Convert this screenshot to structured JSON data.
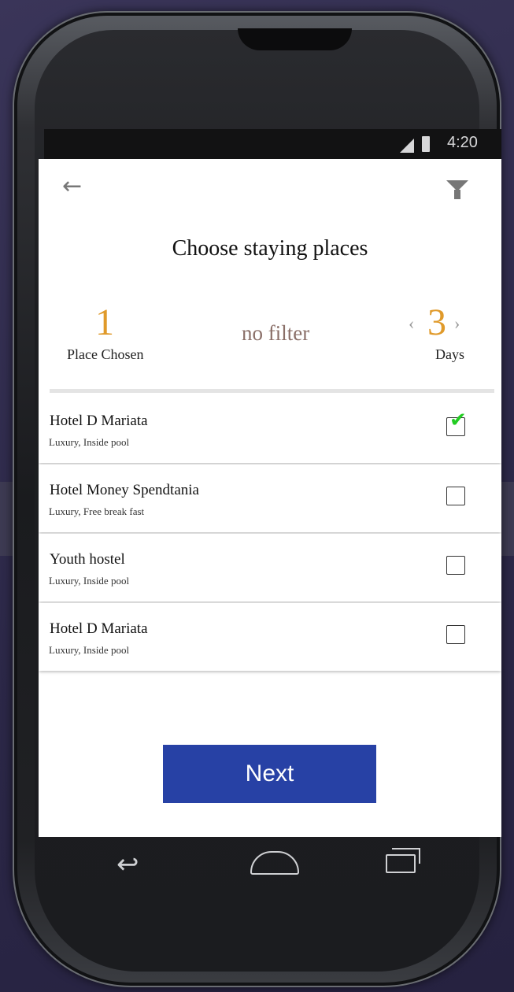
{
  "status_bar": {
    "time": "4:20"
  },
  "header": {
    "title": "Choose staying places"
  },
  "summary": {
    "places_count": "1",
    "places_label": "Place Chosen",
    "filter_text": "no filter",
    "days_prev": "‹",
    "days_count": "3",
    "days_next": "›",
    "days_label": "Days"
  },
  "places": [
    {
      "name": "Hotel D Mariata",
      "description": "Luxury, Inside pool",
      "checked": true
    },
    {
      "name": "Hotel Money Spendtania",
      "description": "Luxury, Free break fast",
      "checked": false
    },
    {
      "name": "Youth hostel",
      "description": "Luxury, Inside pool",
      "checked": false
    },
    {
      "name": "Hotel D Mariata",
      "description": "Luxury, Inside pool",
      "checked": false
    }
  ],
  "check_glyph": "✔",
  "next_label": "Next",
  "icons": {
    "back": "arrow-left-icon",
    "filter": "funnel-icon",
    "nav_back": "nav-back-icon",
    "nav_home": "nav-home-icon",
    "nav_recent": "nav-recent-icon"
  },
  "colors": {
    "accent": "#e09a2a",
    "button": "#2741a5",
    "check": "#22cc22"
  }
}
